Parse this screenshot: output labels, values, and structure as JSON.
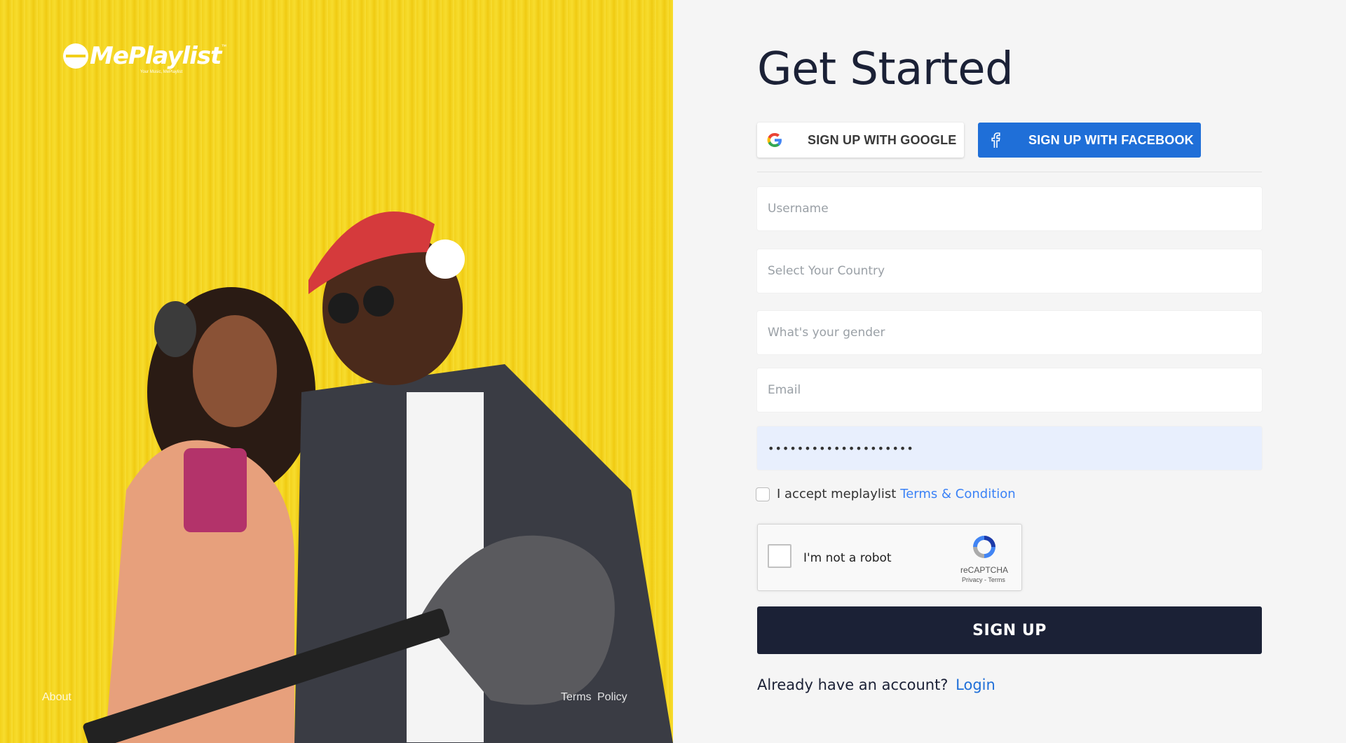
{
  "brand": {
    "name": "MePlaylist",
    "trademark": "™",
    "tagline": "Your Music, MePlaylist"
  },
  "hero": {
    "about_link": "About",
    "terms_link": "Terms",
    "policy_link": "Policy"
  },
  "form": {
    "title": "Get Started",
    "google_button": "SIGN UP WITH GOOGLE",
    "facebook_button": "SIGN UP WITH FACEBOOK",
    "username_placeholder": "Username",
    "country_placeholder": "Select Your Country",
    "gender_placeholder": "What's your gender",
    "email_placeholder": "Email",
    "password_value": "••••••••••••••••••••",
    "accept_text": "I accept meplaylist",
    "terms_link": "Terms & Condition",
    "captcha_label": "I'm not a robot",
    "captcha_brand": "reCAPTCHA",
    "captcha_links": "Privacy - Terms",
    "submit_button": "SIGN UP",
    "already_text": "Already have an account?",
    "login_link": "Login"
  },
  "icons": {
    "google": "google-g-icon",
    "facebook": "facebook-f-icon",
    "recaptcha": "recaptcha-icon"
  },
  "colors": {
    "hero_yellow": "#f3d21b",
    "navy": "#1b2136",
    "facebook_blue": "#1f6fd8",
    "link_blue": "#3b82f6",
    "password_fill": "#e8effd"
  }
}
